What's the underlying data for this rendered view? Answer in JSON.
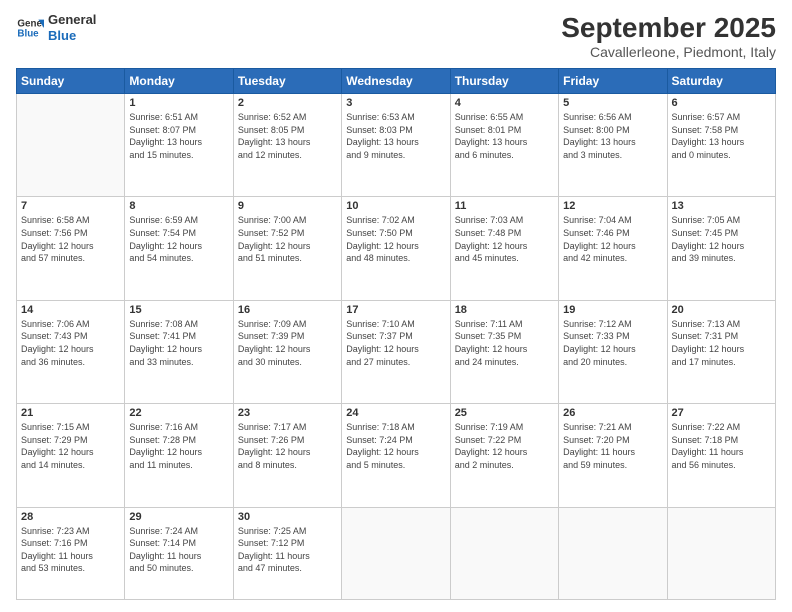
{
  "logo": {
    "line1": "General",
    "line2": "Blue"
  },
  "title": "September 2025",
  "location": "Cavallerleone, Piedmont, Italy",
  "weekdays": [
    "Sunday",
    "Monday",
    "Tuesday",
    "Wednesday",
    "Thursday",
    "Friday",
    "Saturday"
  ],
  "weeks": [
    [
      {
        "day": "",
        "info": ""
      },
      {
        "day": "1",
        "info": "Sunrise: 6:51 AM\nSunset: 8:07 PM\nDaylight: 13 hours\nand 15 minutes."
      },
      {
        "day": "2",
        "info": "Sunrise: 6:52 AM\nSunset: 8:05 PM\nDaylight: 13 hours\nand 12 minutes."
      },
      {
        "day": "3",
        "info": "Sunrise: 6:53 AM\nSunset: 8:03 PM\nDaylight: 13 hours\nand 9 minutes."
      },
      {
        "day": "4",
        "info": "Sunrise: 6:55 AM\nSunset: 8:01 PM\nDaylight: 13 hours\nand 6 minutes."
      },
      {
        "day": "5",
        "info": "Sunrise: 6:56 AM\nSunset: 8:00 PM\nDaylight: 13 hours\nand 3 minutes."
      },
      {
        "day": "6",
        "info": "Sunrise: 6:57 AM\nSunset: 7:58 PM\nDaylight: 13 hours\nand 0 minutes."
      }
    ],
    [
      {
        "day": "7",
        "info": "Sunrise: 6:58 AM\nSunset: 7:56 PM\nDaylight: 12 hours\nand 57 minutes."
      },
      {
        "day": "8",
        "info": "Sunrise: 6:59 AM\nSunset: 7:54 PM\nDaylight: 12 hours\nand 54 minutes."
      },
      {
        "day": "9",
        "info": "Sunrise: 7:00 AM\nSunset: 7:52 PM\nDaylight: 12 hours\nand 51 minutes."
      },
      {
        "day": "10",
        "info": "Sunrise: 7:02 AM\nSunset: 7:50 PM\nDaylight: 12 hours\nand 48 minutes."
      },
      {
        "day": "11",
        "info": "Sunrise: 7:03 AM\nSunset: 7:48 PM\nDaylight: 12 hours\nand 45 minutes."
      },
      {
        "day": "12",
        "info": "Sunrise: 7:04 AM\nSunset: 7:46 PM\nDaylight: 12 hours\nand 42 minutes."
      },
      {
        "day": "13",
        "info": "Sunrise: 7:05 AM\nSunset: 7:45 PM\nDaylight: 12 hours\nand 39 minutes."
      }
    ],
    [
      {
        "day": "14",
        "info": "Sunrise: 7:06 AM\nSunset: 7:43 PM\nDaylight: 12 hours\nand 36 minutes."
      },
      {
        "day": "15",
        "info": "Sunrise: 7:08 AM\nSunset: 7:41 PM\nDaylight: 12 hours\nand 33 minutes."
      },
      {
        "day": "16",
        "info": "Sunrise: 7:09 AM\nSunset: 7:39 PM\nDaylight: 12 hours\nand 30 minutes."
      },
      {
        "day": "17",
        "info": "Sunrise: 7:10 AM\nSunset: 7:37 PM\nDaylight: 12 hours\nand 27 minutes."
      },
      {
        "day": "18",
        "info": "Sunrise: 7:11 AM\nSunset: 7:35 PM\nDaylight: 12 hours\nand 24 minutes."
      },
      {
        "day": "19",
        "info": "Sunrise: 7:12 AM\nSunset: 7:33 PM\nDaylight: 12 hours\nand 20 minutes."
      },
      {
        "day": "20",
        "info": "Sunrise: 7:13 AM\nSunset: 7:31 PM\nDaylight: 12 hours\nand 17 minutes."
      }
    ],
    [
      {
        "day": "21",
        "info": "Sunrise: 7:15 AM\nSunset: 7:29 PM\nDaylight: 12 hours\nand 14 minutes."
      },
      {
        "day": "22",
        "info": "Sunrise: 7:16 AM\nSunset: 7:28 PM\nDaylight: 12 hours\nand 11 minutes."
      },
      {
        "day": "23",
        "info": "Sunrise: 7:17 AM\nSunset: 7:26 PM\nDaylight: 12 hours\nand 8 minutes."
      },
      {
        "day": "24",
        "info": "Sunrise: 7:18 AM\nSunset: 7:24 PM\nDaylight: 12 hours\nand 5 minutes."
      },
      {
        "day": "25",
        "info": "Sunrise: 7:19 AM\nSunset: 7:22 PM\nDaylight: 12 hours\nand 2 minutes."
      },
      {
        "day": "26",
        "info": "Sunrise: 7:21 AM\nSunset: 7:20 PM\nDaylight: 11 hours\nand 59 minutes."
      },
      {
        "day": "27",
        "info": "Sunrise: 7:22 AM\nSunset: 7:18 PM\nDaylight: 11 hours\nand 56 minutes."
      }
    ],
    [
      {
        "day": "28",
        "info": "Sunrise: 7:23 AM\nSunset: 7:16 PM\nDaylight: 11 hours\nand 53 minutes."
      },
      {
        "day": "29",
        "info": "Sunrise: 7:24 AM\nSunset: 7:14 PM\nDaylight: 11 hours\nand 50 minutes."
      },
      {
        "day": "30",
        "info": "Sunrise: 7:25 AM\nSunset: 7:12 PM\nDaylight: 11 hours\nand 47 minutes."
      },
      {
        "day": "",
        "info": ""
      },
      {
        "day": "",
        "info": ""
      },
      {
        "day": "",
        "info": ""
      },
      {
        "day": "",
        "info": ""
      }
    ]
  ]
}
